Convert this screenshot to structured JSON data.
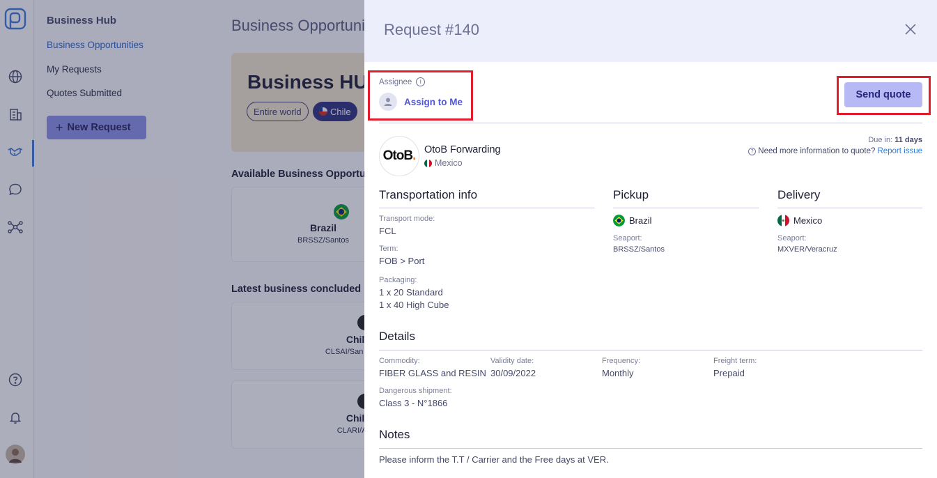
{
  "nav": {
    "title": "Business Hub",
    "items": [
      "Business Opportunities",
      "My Requests",
      "Quotes Submitted"
    ],
    "new_request": "New Request"
  },
  "main": {
    "page_title": "Business Opportunities",
    "hero_title": "Business HUB",
    "chip_world": "Entire world",
    "chip_chile": "Chile",
    "available_title": "Available Business Opportunities",
    "latest_title": "Latest business concluded",
    "card1": {
      "country": "Brazil",
      "port": "BRSSZ/Santos"
    },
    "card2": {
      "country": "Chile",
      "port": "CLSAI/San Antonio"
    },
    "card3": {
      "country": "Chile",
      "port": "CLARI/Arica"
    }
  },
  "drawer": {
    "title": "Request #140",
    "assignee_label": "Assignee",
    "assign_link": "Assign to Me",
    "send_quote": "Send quote",
    "company": "OtoB Forwarding",
    "company_country": "Mexico",
    "due_prefix": "Due in:",
    "due_value": "11 days",
    "more_info": "Need more information to quote?",
    "report_issue": "Report issue",
    "transport": {
      "title": "Transportation info",
      "mode_label": "Transport mode:",
      "mode": "FCL",
      "term_label": "Term:",
      "term": "FOB > Port",
      "packaging_label": "Packaging:",
      "packaging": [
        "1 x 20 Standard",
        "1 x 40 High Cube"
      ]
    },
    "pickup": {
      "title": "Pickup",
      "country": "Brazil",
      "seaport_label": "Seaport:",
      "seaport": "BRSSZ/Santos"
    },
    "delivery": {
      "title": "Delivery",
      "country": "Mexico",
      "seaport_label": "Seaport:",
      "seaport": "MXVER/Veracruz"
    },
    "details": {
      "title": "Details",
      "commodity_label": "Commodity:",
      "commodity": "FIBER GLASS and RESIN",
      "validity_label": "Validity date:",
      "validity": "30/09/2022",
      "frequency_label": "Frequency:",
      "frequency": "Monthly",
      "freight_label": "Freight term:",
      "freight": "Prepaid",
      "dangerous_label": "Dangerous shipment:",
      "dangerous": "Class 3 - N°1866"
    },
    "notes": {
      "title": "Notes",
      "text": "Please inform the T.T / Carrier and the Free days at VER."
    }
  }
}
